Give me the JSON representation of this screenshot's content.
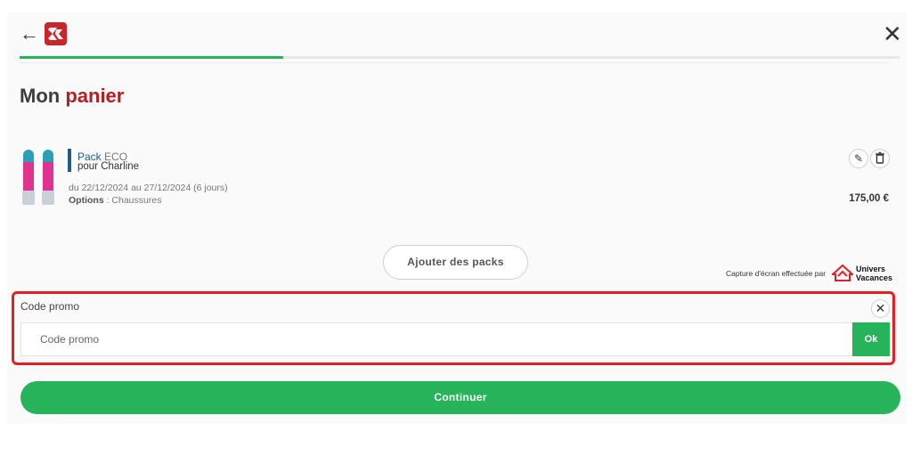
{
  "nav": {
    "back_icon": "arrow-left-icon",
    "close_icon": "close-icon",
    "logo": "SK"
  },
  "progress": {
    "fraction": 0.3
  },
  "page": {
    "title_part1": "Mon",
    "title_part2": "panier"
  },
  "cart_item": {
    "pack_label": "Pack",
    "pack_type": "ECO",
    "for_text": "pour Charline",
    "dates": "du 22/12/2024 au 27/12/2024 (6 jours)",
    "options_label": "Options",
    "options_value": " : Chaussures",
    "price": "175,00 €",
    "edit_icon": "pencil-icon",
    "delete_icon": "trash-icon"
  },
  "add_packs_label": "Ajouter des packs",
  "watermark": {
    "text": "Capture d'écran effectuée par",
    "brand_line1": "Univers",
    "brand_line2": "Vacances"
  },
  "promo": {
    "label": "Code promo",
    "placeholder": "Code promo",
    "value": "",
    "ok_label": "Ok",
    "close_icon": "close-icon"
  },
  "continue_label": "Continuer",
  "colors": {
    "brand_red": "#b41f24",
    "green": "#27b35a",
    "pack_blue": "#1f5b86",
    "highlight_red": "#e41f25"
  }
}
